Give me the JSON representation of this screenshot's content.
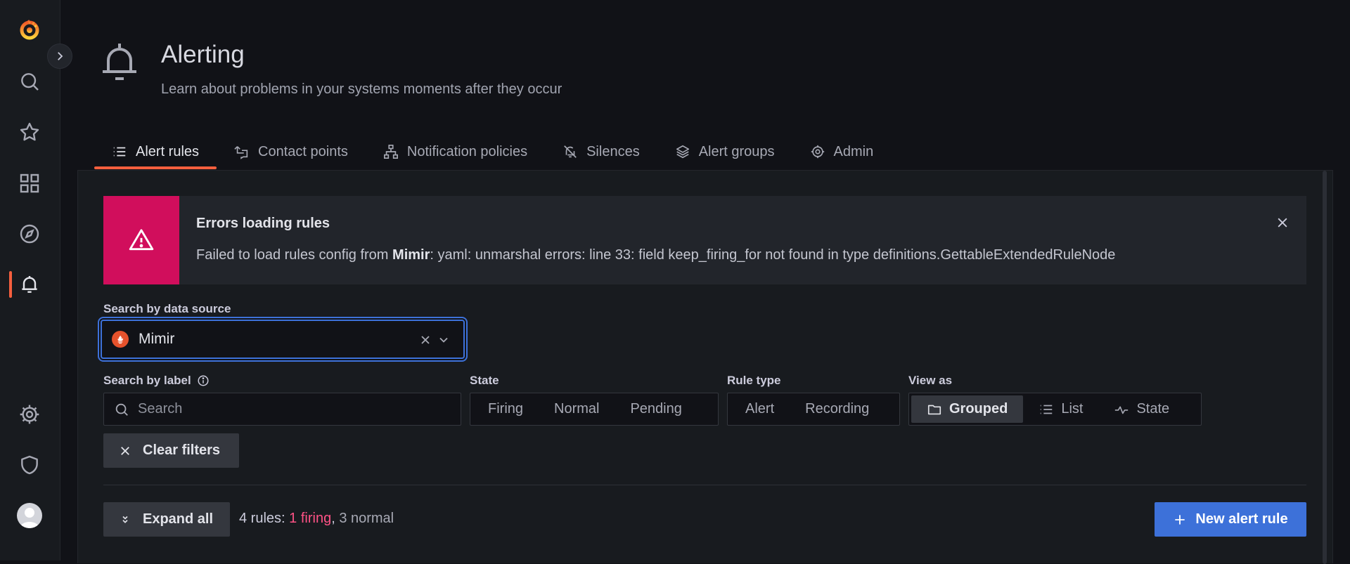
{
  "page": {
    "title": "Alerting",
    "subtitle": "Learn about problems in your systems moments after they occur"
  },
  "sidebar": {
    "items": [
      {
        "name": "grafana-logo",
        "icon": "grafana-logo"
      },
      {
        "name": "search",
        "icon": "search-icon"
      },
      {
        "name": "starred",
        "icon": "star-icon"
      },
      {
        "name": "dashboards",
        "icon": "dashboards-icon"
      },
      {
        "name": "explore",
        "icon": "compass-icon"
      },
      {
        "name": "alerting",
        "icon": "bell-icon",
        "active": true
      },
      {
        "name": "configuration",
        "icon": "gear-icon"
      },
      {
        "name": "server-admin",
        "icon": "shield-icon"
      },
      {
        "name": "profile",
        "icon": "avatar"
      }
    ]
  },
  "tabs": [
    {
      "label": "Alert rules",
      "icon": "list-icon",
      "active": true
    },
    {
      "label": "Contact points",
      "icon": "comment-arrow-icon"
    },
    {
      "label": "Notification policies",
      "icon": "sitemap-icon"
    },
    {
      "label": "Silences",
      "icon": "bell-slash-icon"
    },
    {
      "label": "Alert groups",
      "icon": "layers-icon"
    },
    {
      "label": "Admin",
      "icon": "cog-icon"
    }
  ],
  "error_alert": {
    "title": "Errors loading rules",
    "message_prefix": "Failed to load rules config from ",
    "message_source": "Mimir",
    "message_suffix": ": yaml: unmarshal errors: line 33: field keep_firing_for not found in type definitions.GettableExtendedRuleNode",
    "color": "#d10e5c"
  },
  "filters": {
    "datasource_label": "Search by data source",
    "datasource_value": "Mimir",
    "label_search_label": "Search by label",
    "label_search_placeholder": "Search",
    "state_label": "State",
    "state_options": [
      "Firing",
      "Normal",
      "Pending"
    ],
    "rule_type_label": "Rule type",
    "rule_type_options": [
      "Alert",
      "Recording"
    ],
    "view_as_label": "View as",
    "view_as_options": [
      {
        "label": "Grouped",
        "icon": "folder-icon",
        "selected": true
      },
      {
        "label": "List",
        "icon": "list-icon"
      },
      {
        "label": "State",
        "icon": "heartbeat-icon"
      }
    ],
    "clear_filters_label": "Clear filters"
  },
  "rules_bar": {
    "expand_all_label": "Expand all",
    "summary_prefix": "4 rules: ",
    "summary_firing": "1 firing",
    "summary_sep": ", ",
    "summary_normal": "3 normal",
    "new_rule_label": "New alert rule"
  },
  "colors": {
    "accent": "#f55f3e",
    "primary": "#3d71d9",
    "firing": "#ff5286"
  }
}
